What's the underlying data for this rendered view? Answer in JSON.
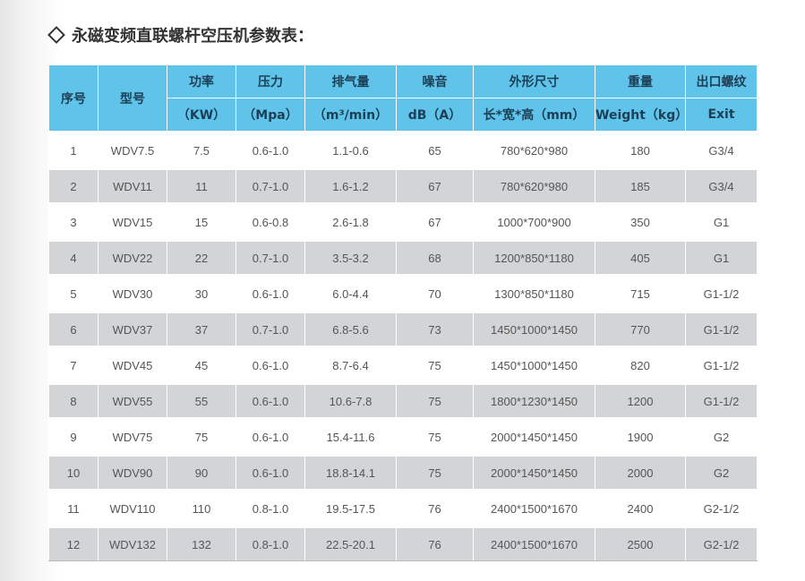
{
  "title": "永磁变频直联螺杆空压机参数表：",
  "headers": {
    "no": "序号",
    "model": "型号",
    "power": "功率",
    "power_unit": "（KW）",
    "pressure": "压力",
    "pressure_unit": "（Mpa）",
    "displacement": "排气量",
    "displacement_unit": "（m³/min）",
    "noise": "噪音",
    "noise_unit": "dB（A）",
    "dimensions": "外形尺寸",
    "dimensions_unit": "长*宽*高（mm）",
    "weight": "重量",
    "weight_unit": "Weight（kg）",
    "outlet": "出口螺纹",
    "outlet_unit": "Exit"
  },
  "rows": [
    [
      "1",
      "WDV7.5",
      "7.5",
      "0.6-1.0",
      "1.1-0.6",
      "65",
      "780*620*980",
      "180",
      "G3/4"
    ],
    [
      "2",
      "WDV11",
      "11",
      "0.7-1.0",
      "1.6-1.2",
      "67",
      "780*620*980",
      "185",
      "G3/4"
    ],
    [
      "3",
      "WDV15",
      "15",
      "0.6-0.8",
      "2.6-1.8",
      "67",
      "1000*700*900",
      "350",
      "G1"
    ],
    [
      "4",
      "WDV22",
      "22",
      "0.7-1.0",
      "3.5-3.2",
      "68",
      "1200*850*1180",
      "405",
      "G1"
    ],
    [
      "5",
      "WDV30",
      "30",
      "0.6-1.0",
      "6.0-4.4",
      "70",
      "1300*850*1180",
      "715",
      "G1-1/2"
    ],
    [
      "6",
      "WDV37",
      "37",
      "0.7-1.0",
      "6.8-5.6",
      "73",
      "1450*1000*1450",
      "770",
      "G1-1/2"
    ],
    [
      "7",
      "WDV45",
      "45",
      "0.6-1.0",
      "8.7-6.4",
      "75",
      "1450*1000*1450",
      "820",
      "G1-1/2"
    ],
    [
      "8",
      "WDV55",
      "55",
      "0.6-1.0",
      "10.6-7.8",
      "75",
      "1800*1230*1450",
      "1200",
      "G1-1/2"
    ],
    [
      "9",
      "WDV75",
      "75",
      "0.6-1.0",
      "15.4-11.6",
      "75",
      "2000*1450*1450",
      "1900",
      "G2"
    ],
    [
      "10",
      "WDV90",
      "90",
      "0.6-1.0",
      "18.8-14.1",
      "75",
      "2000*1450*1450",
      "2000",
      "G2"
    ],
    [
      "11",
      "WDV110",
      "110",
      "0.8-1.0",
      "19.5-17.5",
      "76",
      "2400*1500*1670",
      "2400",
      "G2-1/2"
    ],
    [
      "12",
      "WDV132",
      "132",
      "0.8-1.0",
      "22.5-20.1",
      "76",
      "2400*1500*1670",
      "2500",
      "G2-1/2"
    ]
  ]
}
